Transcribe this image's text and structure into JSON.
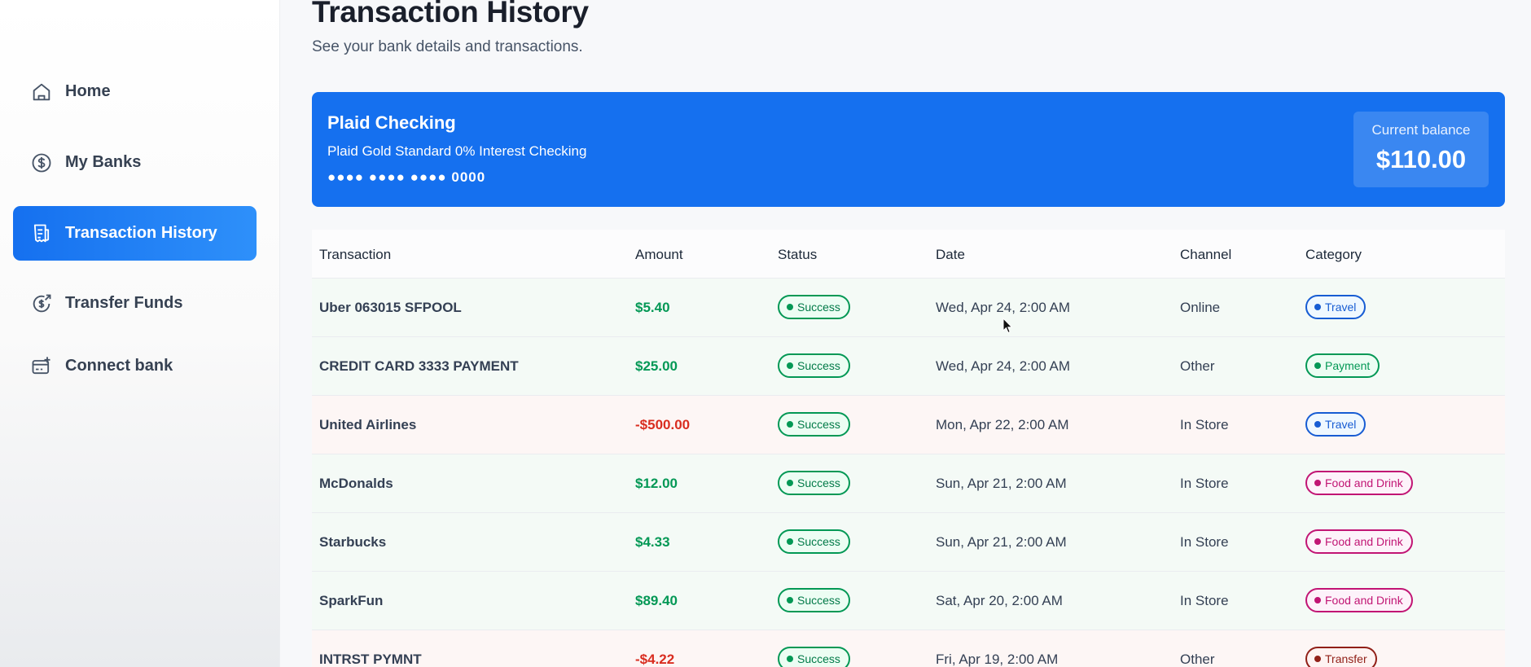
{
  "sidebar": {
    "items": [
      {
        "label": "Home",
        "icon": "home-icon",
        "active": false
      },
      {
        "label": "My Banks",
        "icon": "dollar-circle-icon",
        "active": false
      },
      {
        "label": "Transaction History",
        "icon": "receipt-icon",
        "active": true
      },
      {
        "label": "Transfer Funds",
        "icon": "transfer-icon",
        "active": false
      },
      {
        "label": "Connect bank",
        "icon": "connect-bank-icon",
        "active": false
      }
    ]
  },
  "header": {
    "title": "Transaction History",
    "subtitle": "See your bank details and transactions."
  },
  "bank_card": {
    "name": "Plaid Checking",
    "official_name": "Plaid Gold Standard 0% Interest Checking",
    "mask": "●●●● ●●●● ●●●● 0000",
    "balance_label": "Current balance",
    "balance": "$110.00",
    "color": "#1570ef"
  },
  "table": {
    "columns": [
      "Transaction",
      "Amount",
      "Status",
      "Date",
      "Channel",
      "Category"
    ],
    "rows": [
      {
        "name": "Uber 063015 SFPOOL",
        "amount": "$5.40",
        "type": "pos",
        "status": "Success",
        "date": "Wed, Apr 24, 2:00 AM",
        "channel": "Online",
        "category": "Travel"
      },
      {
        "name": "CREDIT CARD 3333 PAYMENT",
        "amount": "$25.00",
        "type": "pos",
        "status": "Success",
        "date": "Wed, Apr 24, 2:00 AM",
        "channel": "Other",
        "category": "Payment"
      },
      {
        "name": "United Airlines",
        "amount": "-$500.00",
        "type": "neg",
        "status": "Success",
        "date": "Mon, Apr 22, 2:00 AM",
        "channel": "In Store",
        "category": "Travel"
      },
      {
        "name": "McDonalds",
        "amount": "$12.00",
        "type": "pos",
        "status": "Success",
        "date": "Sun, Apr 21, 2:00 AM",
        "channel": "In Store",
        "category": "Food and Drink"
      },
      {
        "name": "Starbucks",
        "amount": "$4.33",
        "type": "pos",
        "status": "Success",
        "date": "Sun, Apr 21, 2:00 AM",
        "channel": "In Store",
        "category": "Food and Drink"
      },
      {
        "name": "SparkFun",
        "amount": "$89.40",
        "type": "pos",
        "status": "Success",
        "date": "Sat, Apr 20, 2:00 AM",
        "channel": "In Store",
        "category": "Food and Drink"
      },
      {
        "name": "INTRST PYMNT",
        "amount": "-$4.22",
        "type": "neg",
        "status": "Success",
        "date": "Fri, Apr 19, 2:00 AM",
        "channel": "Other",
        "category": "Transfer"
      }
    ]
  },
  "colors": {
    "success": "#039855",
    "travel": "#175cd3",
    "payment": "#039855",
    "food": "#c11574",
    "transfer": "#912018"
  }
}
